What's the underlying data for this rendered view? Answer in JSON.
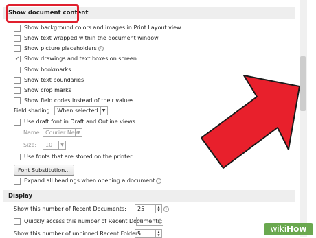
{
  "section_content": {
    "header": "Show document content",
    "options": [
      {
        "label": "Show background colors and images in Print Layout view",
        "checked": false
      },
      {
        "label": "Show text wrapped within the document window",
        "checked": false
      },
      {
        "label": "Show picture placeholders",
        "checked": false,
        "info": true
      },
      {
        "label": "Show drawings and text boxes on screen",
        "checked": true
      },
      {
        "label": "Show bookmarks",
        "checked": false
      },
      {
        "label": "Show text boundaries",
        "checked": false
      },
      {
        "label": "Show crop marks",
        "checked": false
      },
      {
        "label": "Show field codes instead of their values",
        "checked": false
      }
    ],
    "field_shading_label": "Field shading:",
    "field_shading_value": "When selected",
    "draft_font_label": "Use draft font in Draft and Outline views",
    "name_label": "Name:",
    "name_value": "Courier New",
    "size_label": "Size:",
    "size_value": "10",
    "printer_fonts_label": "Use fonts that are stored on the printer",
    "font_substitution_button": "Font Substitution...",
    "expand_headings_label": "Expand all headings when opening a document"
  },
  "section_display": {
    "header": "Display",
    "recent_docs_label": "Show this number of Recent Documents:",
    "recent_docs_value": "25",
    "quick_access_label": "Quickly access this number of Recent Documents:",
    "quick_access_value": "4",
    "recent_folders_label": "Show this number of unpinned Recent Folders:",
    "recent_folders_value": "5"
  },
  "watermark": {
    "part1": "wiki",
    "part2": "How"
  },
  "colors": {
    "highlight": "#e0202e",
    "arrow": "#e8202c",
    "watermark_bg": "#6aa84f"
  },
  "icons": {
    "info": "info-icon",
    "dropdown": "chevron-down-icon",
    "spinner": "spinner-arrows-icon"
  }
}
